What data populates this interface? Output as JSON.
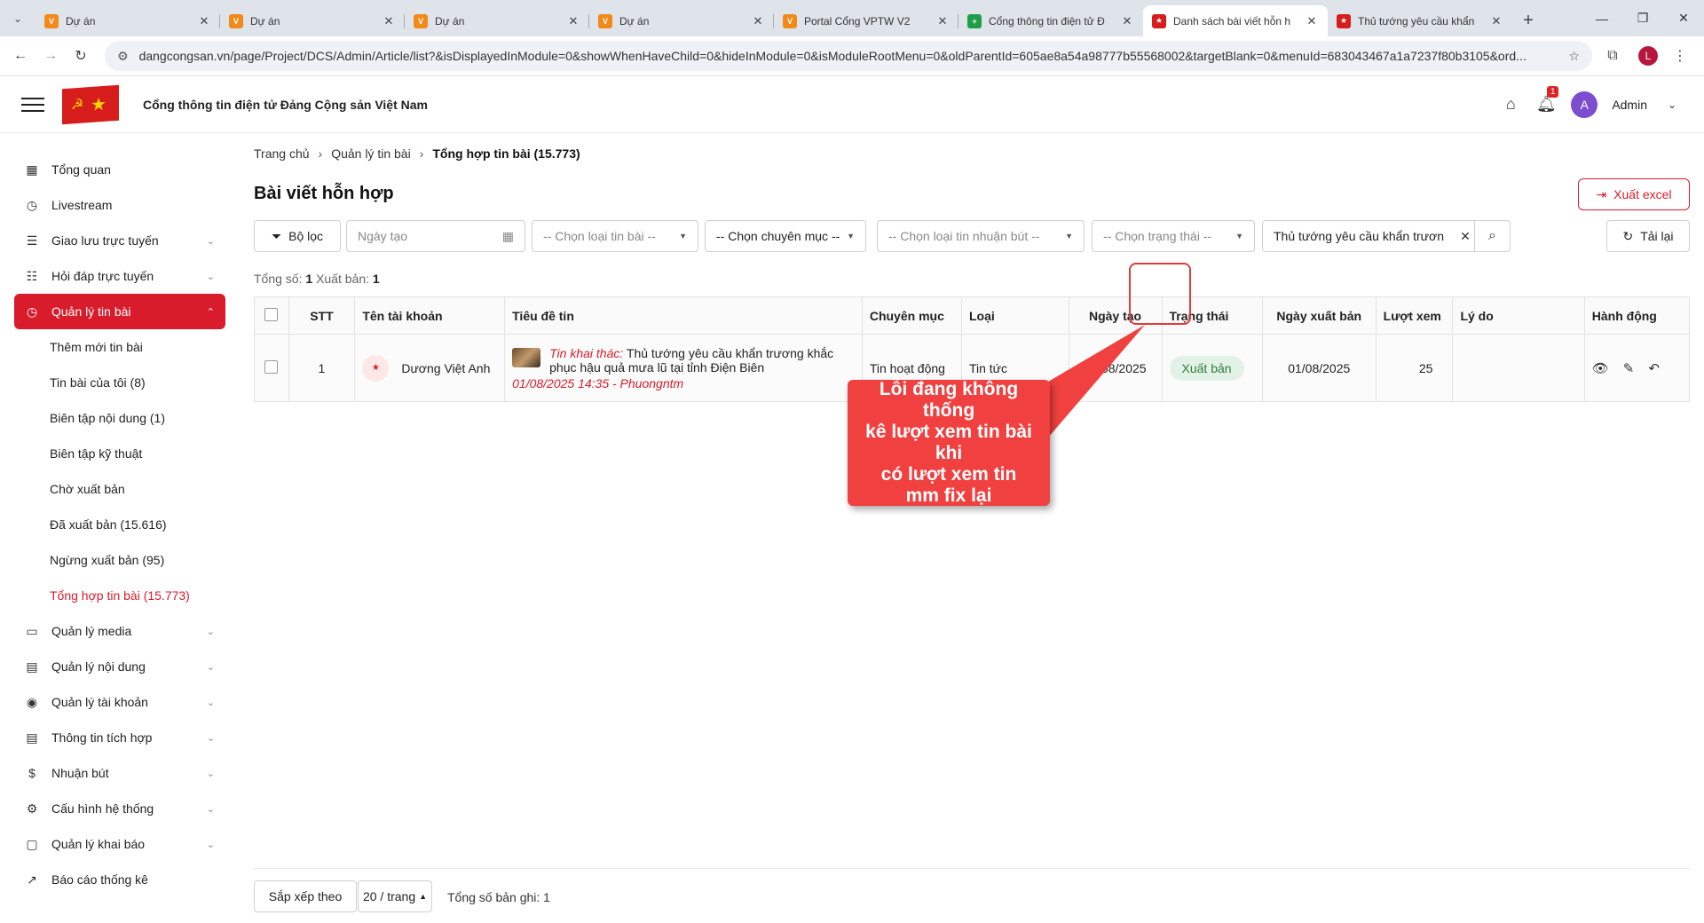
{
  "browser": {
    "tabs": [
      {
        "title": "Dự án",
        "icon": "v-logo",
        "color": "#f28a1a"
      },
      {
        "title": "Dự án",
        "icon": "v-logo",
        "color": "#f28a1a"
      },
      {
        "title": "Dự án",
        "icon": "v-logo",
        "color": "#f28a1a"
      },
      {
        "title": "Dự án",
        "icon": "v-logo",
        "color": "#f28a1a"
      },
      {
        "title": "Portal Cổng VPTW V2",
        "icon": "v-logo",
        "color": "#f28a1a"
      },
      {
        "title": "Cổng thông tin điện tử Đ",
        "icon": "sheets-logo",
        "color": "#1f9e4a"
      },
      {
        "title": "Danh sách bài viết hỗn h",
        "icon": "flag-logo",
        "color": "#d71c1c",
        "active": true
      },
      {
        "title": "Thủ tướng yêu cầu khẩn",
        "icon": "flag-logo",
        "color": "#d71c1c"
      }
    ],
    "url": "dangcongsan.vn/page/Project/DCS/Admin/Article/list?&isDisplayedInModule=0&showWhenHaveChild=0&hideInModule=0&isModuleRootMenu=0&oldParentId=605ae8a54a98777b55568002&targetBlank=0&menuId=683043467a1a7237f80b3105&ord...",
    "profile_initial": "L"
  },
  "header": {
    "title": "Cổng thông tin điện tử Đảng Cộng sản Việt Nam",
    "notification_count": "1",
    "avatar_initial": "A",
    "user_name": "Admin"
  },
  "sidebar": {
    "items": [
      {
        "label": "Tổng quan",
        "icon": "dashboard-icon"
      },
      {
        "label": "Livestream",
        "icon": "clock-icon"
      },
      {
        "label": "Giao lưu trực tuyến",
        "icon": "chat-icon",
        "expandable": true
      },
      {
        "label": "Hỏi đáp trực tuyến",
        "icon": "qa-icon",
        "expandable": true
      },
      {
        "label": "Quản lý tin bài",
        "icon": "clock-icon",
        "expandable": true,
        "active": true
      }
    ],
    "subitems": [
      {
        "label": "Thêm mới tin bài"
      },
      {
        "label": "Tin bài của tôi (8)"
      },
      {
        "label": "Biên tập nội dung (1)"
      },
      {
        "label": "Biên tập kỹ thuật"
      },
      {
        "label": "Chờ xuất bản"
      },
      {
        "label": "Đã xuất bản (15.616)"
      },
      {
        "label": "Ngừng xuất bản (95)"
      },
      {
        "label": "Tổng hợp tin bài (15.773)",
        "current": true
      }
    ],
    "items_after": [
      {
        "label": "Quản lý media",
        "icon": "video-icon"
      },
      {
        "label": "Quản lý nội dung",
        "icon": "document-icon"
      },
      {
        "label": "Quản lý tài khoản",
        "icon": "user-icon"
      },
      {
        "label": "Thông tin tích hợp",
        "icon": "document-icon"
      },
      {
        "label": "Nhuận bút",
        "icon": "dollar-icon"
      },
      {
        "label": "Cấu hình hệ thống",
        "icon": "settings-icon"
      },
      {
        "label": "Quản lý khai báo",
        "icon": "folder-icon"
      },
      {
        "label": "Báo cáo thống kê",
        "icon": "chart-icon",
        "no_chevron": true
      }
    ]
  },
  "breadcrumb": {
    "home": "Trang chủ",
    "section": "Quản lý tin bài",
    "current": "Tổng hợp tin bài (15.773)"
  },
  "page": {
    "title": "Bài viết hỗn hợp",
    "export_label": "Xuất excel"
  },
  "filters": {
    "filter_label": "Bộ lọc",
    "date_placeholder": "Ngày tạo",
    "type_placeholder": "-- Chọn loại tin bài --",
    "category_placeholder": "-- Chọn chuyên mục --",
    "royalty_placeholder": "-- Chọn loại tin nhuận bút --",
    "status_placeholder": "-- Chọn trạng thái --",
    "search_value": "Thủ tướng yêu cầu khẩn trươn",
    "reload_label": "Tải lại"
  },
  "totals": {
    "total_label": "Tổng số:",
    "total": "1",
    "published_label": "Xuất bản:",
    "published": "1"
  },
  "table": {
    "headers": [
      "STT",
      "Tên tài khoản",
      "Tiêu đề tin",
      "Chuyên mục",
      "Loại",
      "Ngày tạo",
      "Trạng thái",
      "Ngày xuất bản",
      "Lượt xem",
      "Lý do",
      "Hành động"
    ],
    "rows": [
      {
        "stt": "1",
        "account": "Dương Việt Anh",
        "source": "Tin khai thác:",
        "title": "Thủ tướng yêu cầu khẩn trương khắc phục hậu quả mưa lũ tại tỉnh Điện Biên",
        "meta": "01/08/2025 14:35 - Phuongntm",
        "category": "Tin hoạt động",
        "type": "Tin tức",
        "created": "01/08/2025",
        "status": "Xuất bản",
        "published": "01/08/2025",
        "views": "25",
        "reason": ""
      }
    ]
  },
  "annotation": {
    "text_lines": [
      "Lỗi đang không thống",
      "kê lượt xem tin bài khi",
      "có lượt xem tin",
      "mm fix lại"
    ],
    "color": "#f0403f"
  },
  "footer": {
    "sort_label": "Sắp xếp theo",
    "page_size": "20 / trang",
    "records_label": "Tổng số bản ghi: 1"
  }
}
